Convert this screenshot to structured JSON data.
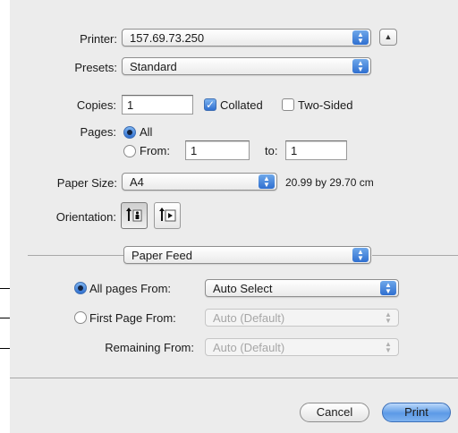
{
  "printer": {
    "label": "Printer:",
    "value": "157.69.73.250"
  },
  "presets": {
    "label": "Presets:",
    "value": "Standard"
  },
  "copies": {
    "label": "Copies:",
    "value": "1",
    "collated_label": "Collated",
    "two_sided_label": "Two-Sided"
  },
  "pages": {
    "label": "Pages:",
    "all_label": "All",
    "from_label": "From:",
    "from_value": "1",
    "to_label": "to:",
    "to_value": "1"
  },
  "paper_size": {
    "label": "Paper Size:",
    "value": "A4",
    "dimensions": "20.99 by 29.70 cm"
  },
  "orientation": {
    "label": "Orientation:"
  },
  "section": {
    "value": "Paper Feed"
  },
  "paper_feed": {
    "all_pages_label": "All pages From:",
    "all_pages_value": "Auto Select",
    "first_page_label": "First Page From:",
    "first_page_value": "Auto (Default)",
    "remaining_label": "Remaining From:",
    "remaining_value": "Auto (Default)"
  },
  "buttons": {
    "cancel": "Cancel",
    "print": "Print"
  },
  "colors": {
    "accent": "#3d7fe0",
    "dialog_bg": "#ececec"
  }
}
